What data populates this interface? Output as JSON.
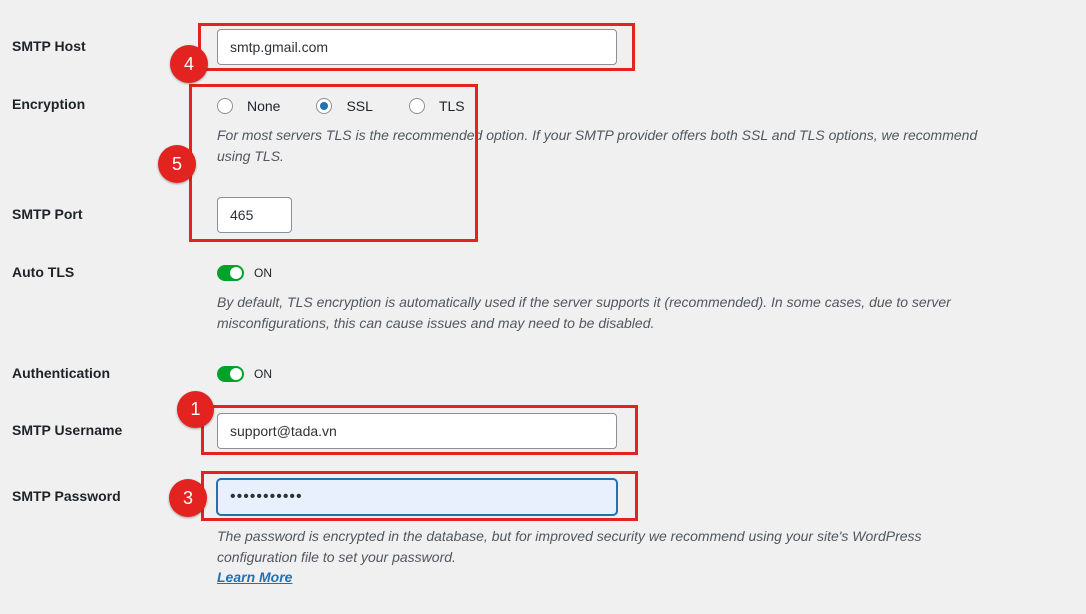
{
  "fields": {
    "smtp_host": {
      "label": "SMTP Host",
      "value": "smtp.gmail.com"
    },
    "encryption": {
      "label": "Encryption",
      "options": [
        "None",
        "SSL",
        "TLS"
      ],
      "selected": "SSL",
      "description_line1": "For most servers TLS is the recommended option. If your SMTP provider offers both SSL and TLS options, we recommend",
      "description_line2": "using TLS."
    },
    "smtp_port": {
      "label": "SMTP Port",
      "value": "465"
    },
    "auto_tls": {
      "label": "Auto TLS",
      "state": "ON",
      "description_line1": "By default, TLS encryption is automatically used if the server supports it (recommended). In some cases, due to server",
      "description_line2": "misconfigurations, this can cause issues and may need to be disabled."
    },
    "authentication": {
      "label": "Authentication",
      "state": "ON"
    },
    "smtp_username": {
      "label": "SMTP Username",
      "value": "support@tada.vn"
    },
    "smtp_password": {
      "label": "SMTP Password",
      "value": "•••••••••••",
      "description_line1": "The password is encrypted in the database, but for improved security we recommend using your site's WordPress",
      "description_line2": "configuration file to set your password.",
      "link_text": "Learn More"
    }
  },
  "annotations": {
    "badge_host": "4",
    "badge_encryption": "5",
    "badge_username": "1",
    "badge_password": "3"
  },
  "colors": {
    "annotation_red": "#e3231f",
    "toggle_on": "#00a32a",
    "accent_blue": "#2271b1",
    "background": "#f0f0f1"
  }
}
